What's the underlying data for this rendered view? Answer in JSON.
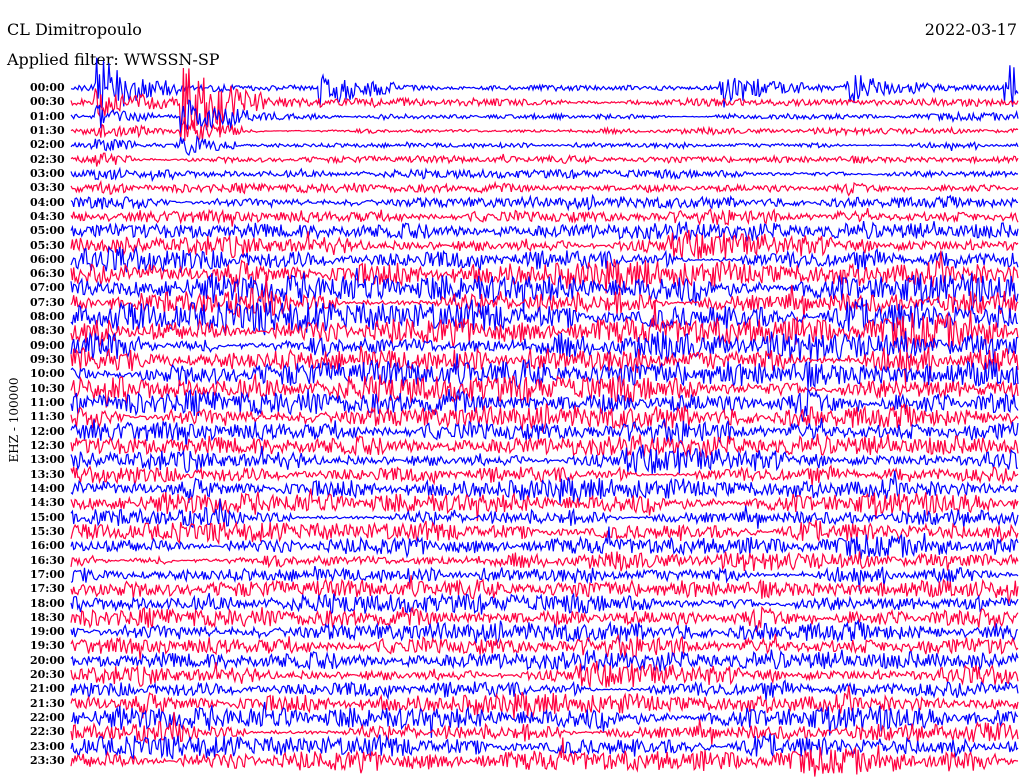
{
  "header": {
    "station": "CL Dimitropoulo",
    "date": "2022-03-17",
    "filter": "Applied filter: WWSSN-SP"
  },
  "chart_data": {
    "type": "line",
    "title": "CL Dimitropoulo",
    "subtitle": "Applied filter: WWSSN-SP",
    "date": "2022-03-17",
    "ylabel": "EHZ - 100000",
    "xlabel": "",
    "row_minutes": 30,
    "row_labels": [
      "00:00",
      "00:30",
      "01:00",
      "01:30",
      "02:00",
      "02:30",
      "03:00",
      "03:30",
      "04:00",
      "04:30",
      "05:00",
      "05:30",
      "06:00",
      "06:30",
      "07:00",
      "07:30",
      "08:00",
      "08:30",
      "09:00",
      "09:30",
      "10:00",
      "10:30",
      "11:00",
      "11:30",
      "12:00",
      "12:30",
      "13:00",
      "13:30",
      "14:00",
      "14:30",
      "15:00",
      "15:30",
      "16:00",
      "16:30",
      "17:00",
      "17:30",
      "18:00",
      "18:30",
      "19:00",
      "19:30",
      "20:00",
      "20:30",
      "21:00",
      "21:30",
      "22:00",
      "22:30",
      "23:00",
      "23:30"
    ],
    "series_colors": [
      "#0000ff",
      "#ff0040"
    ],
    "relative_amplitude": [
      0.35,
      0.4,
      0.35,
      0.35,
      0.35,
      0.4,
      0.45,
      0.5,
      0.6,
      0.7,
      0.9,
      1.1,
      1.2,
      1.3,
      1.4,
      1.5,
      1.6,
      1.6,
      1.6,
      1.6,
      1.5,
      1.4,
      1.3,
      1.2,
      1.1,
      1.1,
      1.1,
      1.0,
      1.0,
      1.0,
      1.0,
      1.0,
      1.0,
      1.0,
      1.0,
      1.0,
      1.0,
      1.0,
      1.0,
      1.0,
      1.0,
      1.0,
      1.0,
      1.0,
      1.1,
      1.1,
      1.1,
      1.2
    ],
    "events": [
      {
        "row": "00:30",
        "minute": 3.6,
        "amplitude": 6,
        "duration_rows": 4
      },
      {
        "row": "00:00",
        "minute": 8.0,
        "amplitude": 2.5,
        "duration_rows": 1
      },
      {
        "row": "00:00",
        "minute": 20.7,
        "amplitude": 2.5,
        "duration_rows": 1
      },
      {
        "row": "00:00",
        "minute": 24.7,
        "amplitude": 2,
        "duration_rows": 1
      },
      {
        "row": "00:00",
        "minute": 29.7,
        "amplitude": 3,
        "duration_rows": 1
      },
      {
        "row": "00:00",
        "minute": 0.9,
        "amplitude": 4,
        "duration_rows": 48
      }
    ]
  }
}
